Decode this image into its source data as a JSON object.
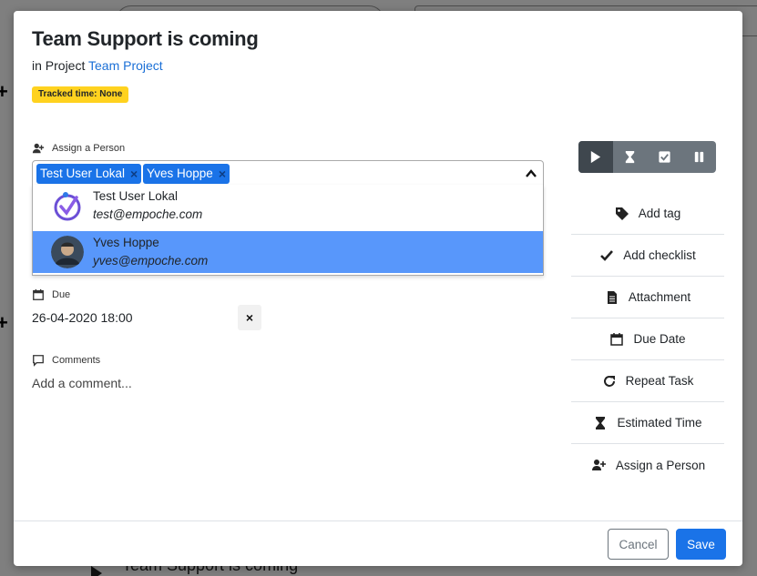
{
  "modal": {
    "title": "Team Support is coming",
    "subtitle_prefix": "in Project",
    "project_link": "Team Project",
    "tracked_badge": "Tracked time: None"
  },
  "assign": {
    "label": "Assign a Person",
    "selected": [
      "Test User Lokal",
      "Yves Hoppe"
    ],
    "chip_remove": "×",
    "options": [
      {
        "name": "Test User Lokal",
        "email": "test@empoche.com",
        "highlighted": false
      },
      {
        "name": "Yves Hoppe",
        "email": "yves@empoche.com",
        "highlighted": true
      }
    ]
  },
  "due": {
    "label": "Due",
    "value": "26-04-2020 18:00",
    "clear": "×"
  },
  "comments": {
    "label": "Comments",
    "placeholder": "Add a comment..."
  },
  "timer": {
    "buttons": [
      "play-icon",
      "hourglass-icon",
      "check-square-icon",
      "pause-icon"
    ],
    "active": "play-icon"
  },
  "actions": [
    {
      "label": "Add tag",
      "icon": "tag-icon"
    },
    {
      "label": "Add checklist",
      "icon": "check-icon"
    },
    {
      "label": "Attachment",
      "icon": "file-icon"
    },
    {
      "label": "Due Date",
      "icon": "calendar-icon"
    },
    {
      "label": "Repeat Task",
      "icon": "redo-icon"
    },
    {
      "label": "Estimated Time",
      "icon": "hourglass-icon"
    },
    {
      "label": "Assign a Person",
      "icon": "user-plus-icon"
    }
  ],
  "footer": {
    "cancel": "Cancel",
    "save": "Save"
  },
  "background": {
    "task_title": "Team Support is coming"
  },
  "colors": {
    "primary": "#1a73e8",
    "link": "#1a6fd6",
    "badge": "#ffd21f",
    "highlight": "#5897fb",
    "timer_bg": "#6c757d"
  }
}
